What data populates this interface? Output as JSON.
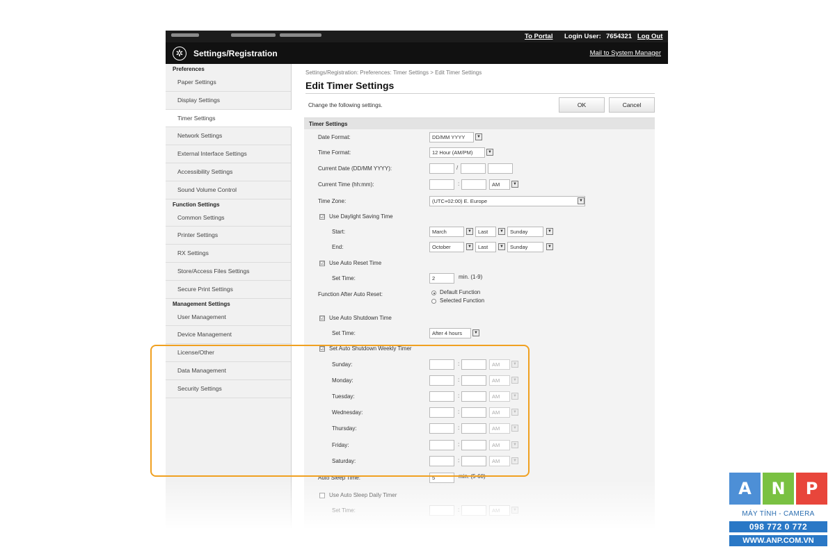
{
  "topbar": {
    "to_portal": "To Portal",
    "login_user_label": "Login User:",
    "login_user_value": "7654321",
    "log_out": "Log Out"
  },
  "header": {
    "title": "Settings/Registration",
    "mail": "Mail to System Manager",
    "logo_icon": "settings-gear-icon"
  },
  "sidebar": {
    "groups": [
      {
        "label": "Preferences",
        "items": [
          "Paper Settings",
          "Display Settings",
          "Timer Settings",
          "Network Settings",
          "External Interface Settings",
          "Accessibility Settings",
          "Sound Volume Control"
        ]
      },
      {
        "label": "Function Settings",
        "items": [
          "Common Settings",
          "Printer Settings",
          "RX Settings",
          "Store/Access Files Settings",
          "Secure Print Settings"
        ]
      },
      {
        "label": "Management Settings",
        "items": [
          "User Management",
          "Device Management",
          "License/Other",
          "Data Management",
          "Security Settings"
        ]
      }
    ],
    "active": "Timer Settings"
  },
  "main": {
    "breadcrumb": "Settings/Registration: Preferences: Timer Settings > Edit Timer Settings",
    "title": "Edit Timer Settings",
    "instruction": "Change the following settings.",
    "ok": "OK",
    "cancel": "Cancel"
  },
  "timer": {
    "section_title": "Timer Settings",
    "date_format_label": "Date Format:",
    "date_format_value": "DD/MM YYYY",
    "time_format_label": "Time Format:",
    "time_format_value": "12 Hour (AM/PM)",
    "current_date_label": "Current Date (DD/MM YYYY):",
    "date_sep": "/",
    "current_time_label": "Current Time (hh:mm):",
    "time_sep": ":",
    "ampm": "AM",
    "time_zone_label": "Time Zone:",
    "time_zone_value": "(UTC+02:00) E. Europe",
    "use_dst_label": "Use Daylight Saving Time",
    "start_label": "Start:",
    "start_month": "March",
    "start_week": "Last",
    "start_day": "Sunday",
    "end_label": "End:",
    "end_month": "October",
    "end_week": "Last",
    "end_day": "Sunday",
    "use_auto_reset_label": "Use Auto Reset Time",
    "set_time_label": "Set Time:",
    "auto_reset_value": "2",
    "auto_reset_unit": "min. (1-9)",
    "function_after_label": "Function After Auto Reset:",
    "default_function": "Default Function",
    "selected_function": "Selected Function",
    "use_auto_shutdown_label": "Use Auto Shutdown Time",
    "auto_shutdown_value": "After 4 hours",
    "set_weekly_label": "Set Auto Shutdown Weekly Timer",
    "days": [
      "Sunday:",
      "Monday:",
      "Tuesday:",
      "Wednesday:",
      "Thursday:",
      "Friday:",
      "Saturday:"
    ],
    "auto_sleep_label": "Auto Sleep Time:",
    "auto_sleep_value": "5",
    "auto_sleep_unit": "min. (5-60)",
    "use_sleep_daily_label": "Use Auto Sleep Daily Timer",
    "sleep_set_time_label": "Set Time:",
    "checkmark": "☑"
  },
  "branding": {
    "a": "A",
    "n": "N",
    "p": "P",
    "tagline": "MÁY TÍNH - CAMERA",
    "phone": "098 772 0 772",
    "web": "WWW.ANP.COM.VN",
    "colors": {
      "a": "#4d8fd6",
      "n": "#7ac142",
      "p": "#e8463b",
      "blue": "#2a78c6"
    }
  }
}
